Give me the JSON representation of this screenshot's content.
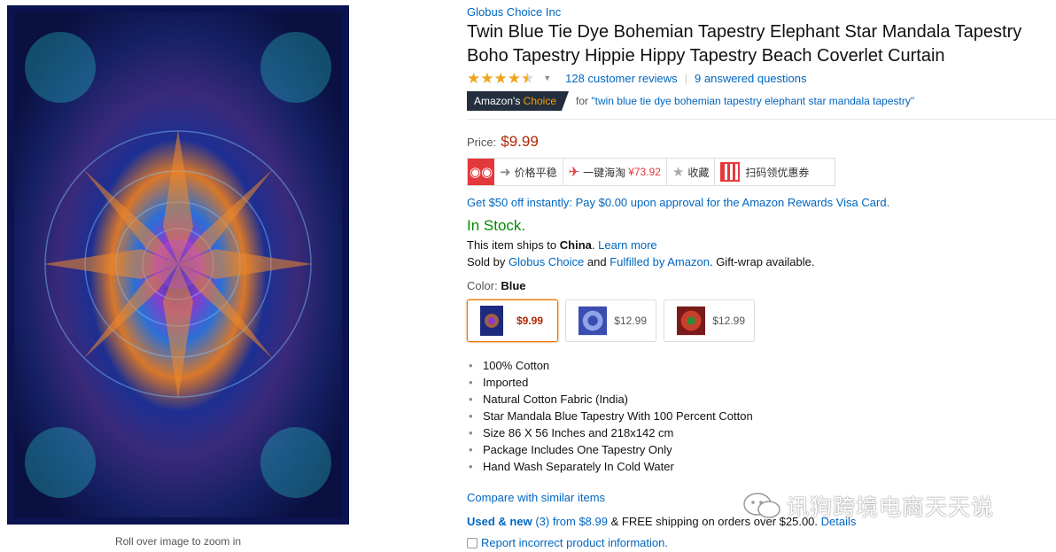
{
  "image_panel": {
    "zoom_hint": "Roll over image to zoom in"
  },
  "product": {
    "brand": "Globus Choice Inc",
    "title": "Twin Blue Tie Dye Bohemian Tapestry Elephant Star Mandala Tapestry Boho Tapestry Hippie Hippy Tapestry Beach Coverlet Curtain",
    "title_line1": "Twin Blue Tie Dye Bohemian Tapestry Elephant Star Mandala Tapestry",
    "title_line2": "Boho Tapestry Hippie Hippy Tapestry Beach Coverlet Curtain",
    "rating": 4.5,
    "reviews": "128 customer reviews",
    "answered": "9 answered questions"
  },
  "choice": {
    "badge_main": "Amazon's",
    "badge_accent": "Choice",
    "for_label": "for",
    "query": "\"twin blue tie dye bohemian tapestry elephant star mandala tapestry\""
  },
  "price": {
    "label": "Price:",
    "value": "$9.99"
  },
  "toolbar": {
    "owl_label": "◉◉",
    "price_stable": "价格平稳",
    "oneclick": "一键海淘",
    "oneclick_price": "¥73.92",
    "favorite": "收藏",
    "scan": "扫码领优惠券"
  },
  "promo": "Get $50 off instantly: Pay $0.00 upon approval for the Amazon Rewards Visa Card.",
  "availability": {
    "stock": "In Stock.",
    "ships_prefix": "This item ships to",
    "ships_country": "China",
    "ships_suffix": ".",
    "learn_more": "Learn more",
    "sold_by": "Sold by",
    "seller": "Globus Choice",
    "and": "and",
    "fulfilled": "Fulfilled by Amazon",
    "gift": ". Gift-wrap available."
  },
  "color": {
    "label": "Color:",
    "selected": "Blue",
    "options": [
      {
        "price": "$9.99"
      },
      {
        "price": "$12.99"
      },
      {
        "price": "$12.99"
      }
    ]
  },
  "bullets": [
    "100% Cotton",
    "Imported",
    "Natural Cotton Fabric (India)",
    "Star Mandala Blue Tapestry With 100 Percent Cotton",
    "Size 86 X 56 Inches and 218x142 cm",
    "Package Includes One Tapestry Only",
    "Hand Wash Separately In Cold Water"
  ],
  "compare": "Compare with similar items",
  "used_new": {
    "label": "Used & new",
    "count": "(3)",
    "from": "from $8.99",
    "shipping": "& FREE shipping on orders over $25.00.",
    "details": "Details"
  },
  "report": "Report incorrect product information.",
  "watermark": "讯狗跨境电商天天说",
  "colors": {
    "link": "#0066c0",
    "price": "#b12704",
    "stock": "#008a00",
    "badge": "#232f3e",
    "accent": "#ff9900"
  }
}
